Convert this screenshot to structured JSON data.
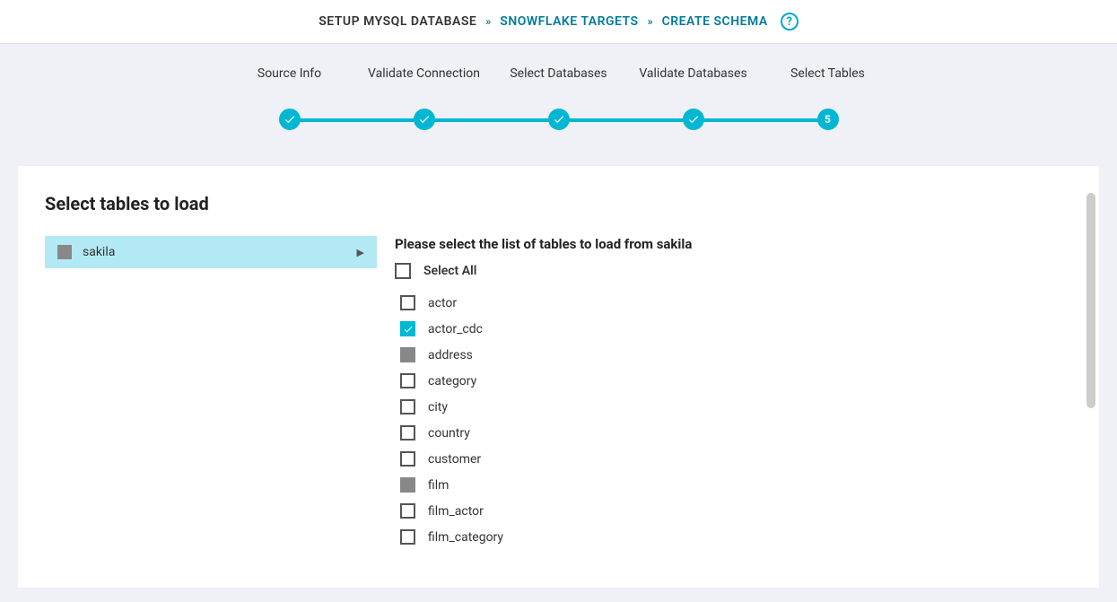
{
  "breadcrumb": {
    "items": [
      {
        "label": "SETUP MYSQL DATABASE",
        "active": true
      },
      {
        "label": "SNOWFLAKE TARGETS",
        "active": false
      },
      {
        "label": "CREATE SCHEMA",
        "active": false
      }
    ]
  },
  "stepper": {
    "steps": [
      {
        "label": "Source Info",
        "done": true
      },
      {
        "label": "Validate Connection",
        "done": true
      },
      {
        "label": "Select Databases",
        "done": true
      },
      {
        "label": "Validate Databases",
        "done": true
      },
      {
        "label": "Select Tables",
        "done": false,
        "number": "5"
      }
    ]
  },
  "card": {
    "title": "Select tables to load",
    "databases": [
      {
        "name": "sakila",
        "state": "indeterminate"
      }
    ],
    "table_prompt": "Please select the list of tables to load from sakila",
    "select_all_label": "Select All",
    "tables": [
      {
        "name": "actor",
        "state": "unchecked"
      },
      {
        "name": "actor_cdc",
        "state": "checked"
      },
      {
        "name": "address",
        "state": "indeterminate"
      },
      {
        "name": "category",
        "state": "unchecked"
      },
      {
        "name": "city",
        "state": "unchecked"
      },
      {
        "name": "country",
        "state": "unchecked"
      },
      {
        "name": "customer",
        "state": "unchecked"
      },
      {
        "name": "film",
        "state": "indeterminate"
      },
      {
        "name": "film_actor",
        "state": "unchecked"
      },
      {
        "name": "film_category",
        "state": "unchecked"
      }
    ]
  }
}
